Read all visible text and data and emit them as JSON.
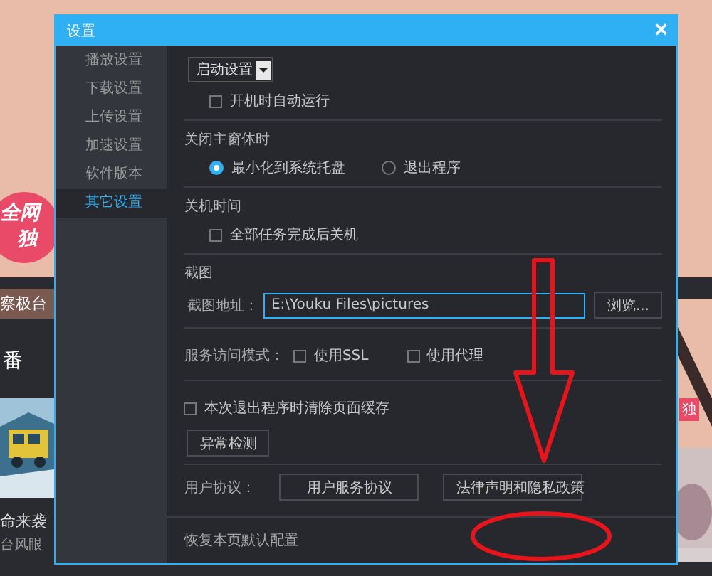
{
  "background": {
    "badge": [
      "全网",
      "独"
    ],
    "left_texts": [
      "察极台",
      "番",
      "命来袭",
      "台风眼"
    ],
    "right_tag": "独"
  },
  "window": {
    "title": "设置",
    "close": "×"
  },
  "sidebar": {
    "items": [
      {
        "label": "播放设置",
        "selected": false
      },
      {
        "label": "下载设置",
        "selected": false
      },
      {
        "label": "上传设置",
        "selected": false
      },
      {
        "label": "加速设置",
        "selected": false
      },
      {
        "label": "软件版本",
        "selected": false
      },
      {
        "label": "其它设置",
        "selected": true
      }
    ]
  },
  "startup": {
    "dropdown": "启动设置",
    "option": {
      "label": "开机时自动运行",
      "checked": false
    }
  },
  "close_main_window": {
    "heading": "关闭主窗体时",
    "options": [
      {
        "label": "最小化到系统托盘",
        "selected": true
      },
      {
        "label": "退出程序",
        "selected": false
      }
    ]
  },
  "shutdown": {
    "heading": "关机时间",
    "option": {
      "label": "全部任务完成后关机",
      "checked": false
    }
  },
  "screenshot": {
    "heading": "截图",
    "path_label": "截图地址：",
    "path": "E:\\Youku Files\\pictures",
    "browse": "浏览..."
  },
  "service": {
    "label": "服务访问模式：",
    "options": [
      {
        "label": "使用SSL",
        "checked": false
      },
      {
        "label": "使用代理",
        "checked": false
      }
    ]
  },
  "cache": {
    "label": "本次退出程序时清除页面缓存",
    "checked": false
  },
  "diagnose_button": "异常检测",
  "agreement": {
    "label": "用户协议：",
    "buttons": [
      "用户服务协议",
      "法律声明和隐私政策"
    ]
  },
  "footer": {
    "reset": "恢复本页默认配置"
  }
}
